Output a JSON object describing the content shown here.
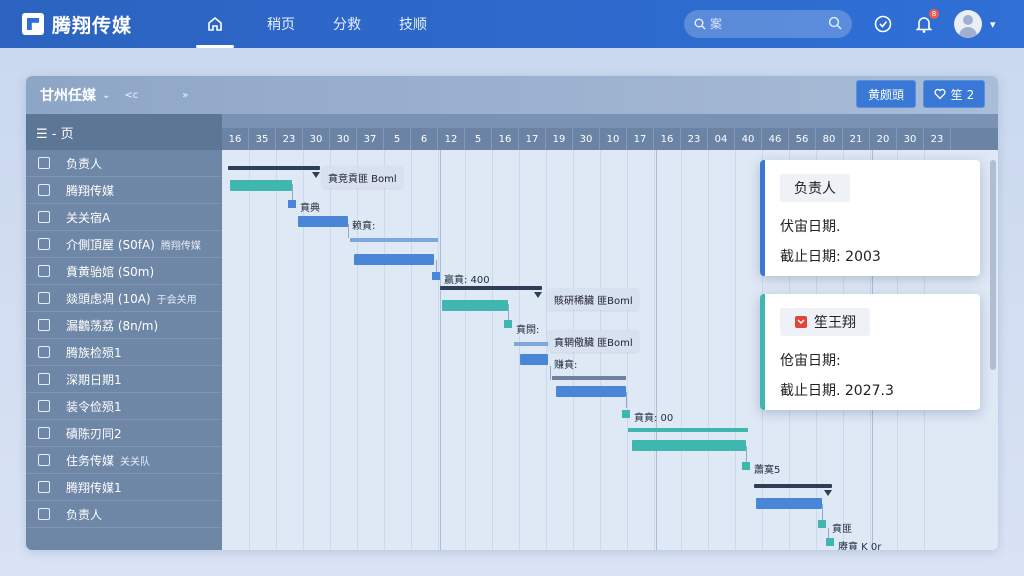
{
  "app": {
    "brand": "腾翔传媒"
  },
  "nav": {
    "items": [
      {
        "label": ""
      },
      {
        "label": "稍页"
      },
      {
        "label": "分救"
      },
      {
        "label": "技顺"
      }
    ]
  },
  "search": {
    "placeholder": "案"
  },
  "notifications": {
    "count": "8"
  },
  "project": {
    "title": "甘州任媒",
    "extra1": "<c",
    "extra2": "»",
    "btn_primary": "黄颇頭",
    "btn_second": "笙 2"
  },
  "tasklist": {
    "header": "☰ - 页",
    "rows": [
      {
        "label": "负责人"
      },
      {
        "label": "腾翔传媒"
      },
      {
        "label": "关关宿A"
      },
      {
        "label": "介側頂屋 (S0fA)",
        "sub": "腾翔传媒"
      },
      {
        "label": "賁黄骀婠 (S0m)"
      },
      {
        "label": "燚頭虑凋 (10A)",
        "sub": "于会关用"
      },
      {
        "label": "漏鸛荡荔 (8n/m)"
      },
      {
        "label": "腾族检殒1"
      },
      {
        "label": "深期日期1"
      },
      {
        "label": "装令俭殒1"
      },
      {
        "label": "磧陈刃同2"
      },
      {
        "label": "住务传媒",
        "sub": "关关队"
      },
      {
        "label": "腾翔传媒1"
      },
      {
        "label": "负责人"
      }
    ]
  },
  "timeline": {
    "days": [
      "16",
      "35",
      "23",
      "30",
      "30",
      "37",
      "5",
      "6",
      "12",
      "5",
      "16",
      "17",
      "19",
      "30",
      "10",
      "17",
      "16",
      "23",
      "04",
      "40",
      "46",
      "56",
      "80",
      "21",
      "20",
      "30",
      "23"
    ]
  },
  "gantt_labels": {
    "tag1": "賁竞貢匪 Boml",
    "lbl1": "賁典",
    "lbl2": "赖賁:",
    "lbl3": "赢賁: 400",
    "tag2": "賅硏稀臟 匪Boml",
    "lbl4": "賁閖:",
    "tag3": "賁辋儆臟 匪Boml",
    "lbl5": "赚賁:",
    "lbl6": "賁賁: 00",
    "lbl7": "蕭寞5",
    "lbl8": "賁匪",
    "lbl9": "赓賁 K 0r"
  },
  "cards": [
    {
      "chip": "负责人",
      "start_label": "伏宙日期.",
      "end_label": "截止日期: 2003",
      "accent": "#3a78d6"
    },
    {
      "chip": "笙王翔",
      "start_label": "伧宙日期:",
      "end_label": "截止日期. 2027.3",
      "accent": "#3fb6ae"
    }
  ],
  "colors": {
    "primary": "#2f6fd6",
    "teal": "#3fb6ae",
    "blue_bar": "#4a86d8",
    "dark_bar": "#2e3e57"
  }
}
